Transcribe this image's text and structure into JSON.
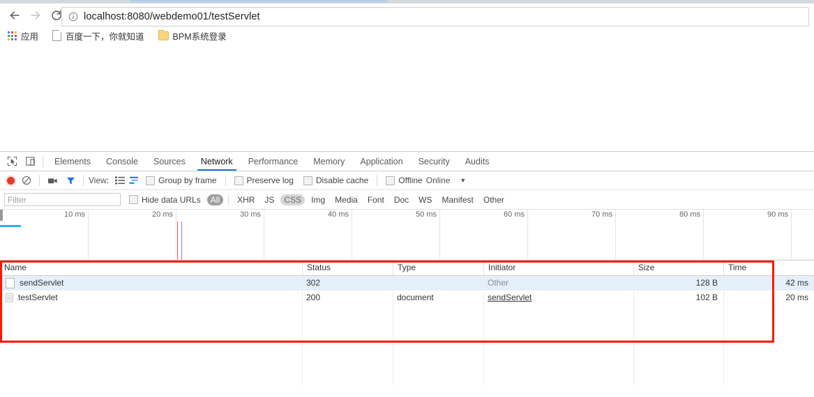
{
  "browser": {
    "nav": {
      "back_icon": "arrow-left-icon",
      "forward_icon": "arrow-right-icon",
      "reload_icon": "reload-icon"
    },
    "omnibox": {
      "info_icon": "info-circle-icon",
      "url_host": "localhost",
      "url_port": ":8080",
      "url_path": "/webdemo01/testServlet",
      "full_url": "localhost:8080/webdemo01/testServlet"
    },
    "bookmarks": [
      {
        "icon": "apps-grid-icon",
        "label": "应用"
      },
      {
        "icon": "page-icon",
        "label": "百度一下，你就知道"
      },
      {
        "icon": "folder-icon",
        "label": "BPM系统登录"
      }
    ]
  },
  "devtools": {
    "inspect_icon": "inspect-element-icon",
    "device_icon": "device-toolbar-icon",
    "tabs": [
      {
        "label": "Elements",
        "active": false
      },
      {
        "label": "Console",
        "active": false
      },
      {
        "label": "Sources",
        "active": false
      },
      {
        "label": "Network",
        "active": true
      },
      {
        "label": "Performance",
        "active": false
      },
      {
        "label": "Memory",
        "active": false
      },
      {
        "label": "Application",
        "active": false
      },
      {
        "label": "Security",
        "active": false
      },
      {
        "label": "Audits",
        "active": false
      }
    ],
    "toolbar": {
      "record_icon": "record-button-icon",
      "clear_icon": "clear-icon",
      "capture_screenshots_icon": "camera-icon",
      "filter_icon": "filter-funnel-icon",
      "view_label": "View:",
      "view_list_icon": "list-view-icon",
      "view_waterfall_icon": "waterfall-view-icon",
      "group_by_frame": "Group by frame",
      "preserve_log": "Preserve log",
      "disable_cache": "Disable cache",
      "offline": "Offline",
      "online": "Online",
      "overflow_icon": "chevron-down-icon"
    },
    "filterbar": {
      "filter_placeholder": "Filter",
      "filter_value": "",
      "hide_data_urls": "Hide data URLs",
      "types": [
        {
          "label": "All",
          "state": "selected"
        },
        {
          "label": "XHR",
          "state": "normal"
        },
        {
          "label": "JS",
          "state": "normal"
        },
        {
          "label": "CSS",
          "state": "hover"
        },
        {
          "label": "Img",
          "state": "normal"
        },
        {
          "label": "Media",
          "state": "normal"
        },
        {
          "label": "Font",
          "state": "normal"
        },
        {
          "label": "Doc",
          "state": "normal"
        },
        {
          "label": "WS",
          "state": "normal"
        },
        {
          "label": "Manifest",
          "state": "normal"
        },
        {
          "label": "Other",
          "state": "normal"
        }
      ]
    },
    "overview": {
      "ticks": [
        "10 ms",
        "20 ms",
        "30 ms",
        "40 ms",
        "50 ms",
        "60 ms",
        "70 ms",
        "80 ms",
        "90 ms"
      ],
      "request_bar_color": "#25b3f0",
      "dom_content_loaded_color": "#0d47f0",
      "load_event_color": "#f05050"
    },
    "table": {
      "columns": [
        "Name",
        "Status",
        "Type",
        "Initiator",
        "Size",
        "Time"
      ],
      "rows": [
        {
          "icon": "blank-file-icon",
          "name": "sendServlet",
          "status": "302",
          "type": "",
          "initiator": "Other",
          "initiator_style": "muted",
          "size": "128 B",
          "time": "42 ms",
          "selected": true
        },
        {
          "icon": "document-file-icon",
          "name": "testServlet",
          "status": "200",
          "type": "document",
          "initiator": "sendServlet",
          "initiator_style": "link",
          "size": "102 B",
          "time": "20 ms",
          "selected": false
        }
      ]
    }
  },
  "annotation": {
    "highlight_color": "#fb1800"
  }
}
